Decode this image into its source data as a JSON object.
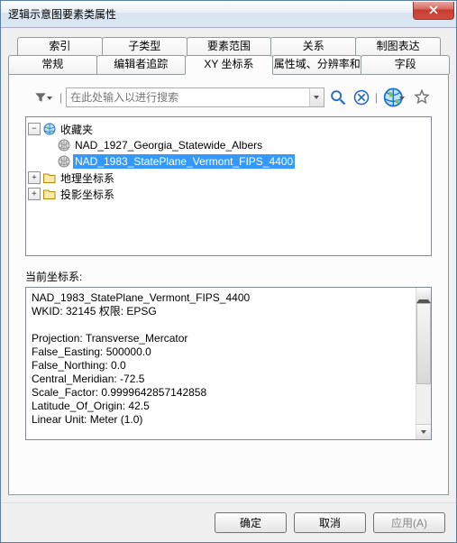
{
  "title": "逻辑示意图要素类属性",
  "tabs_row1": [
    "索引",
    "子类型",
    "要素范围",
    "关系",
    "制图表达"
  ],
  "tabs_row2": [
    "常规",
    "编辑者追踪",
    "XY 坐标系",
    "属性域、分辨率和容差",
    "字段"
  ],
  "active_tab": "XY 坐标系",
  "search_placeholder": "在此处输入以进行搜索",
  "tree": {
    "root": {
      "label": "收藏夹",
      "expanded": true
    },
    "items": [
      {
        "label": "NAD_1927_Georgia_Statewide_Albers",
        "selected": false
      },
      {
        "label": "NAD_1983_StatePlane_Vermont_FIPS_4400",
        "selected": true
      }
    ],
    "folders": [
      {
        "label": "地理坐标系",
        "expanded": false
      },
      {
        "label": "投影坐标系",
        "expanded": false
      }
    ]
  },
  "current_label": "当前坐标系:",
  "current_text": "NAD_1983_StatePlane_Vermont_FIPS_4400\nWKID: 32145 权限: EPSG\n\nProjection: Transverse_Mercator\nFalse_Easting: 500000.0\nFalse_Northing: 0.0\nCentral_Meridian: -72.5\nScale_Factor: 0.9999642857142858\nLatitude_Of_Origin: 42.5\nLinear Unit: Meter (1.0)\n",
  "buttons": {
    "ok": "确定",
    "cancel": "取消",
    "apply": "应用(A)"
  }
}
